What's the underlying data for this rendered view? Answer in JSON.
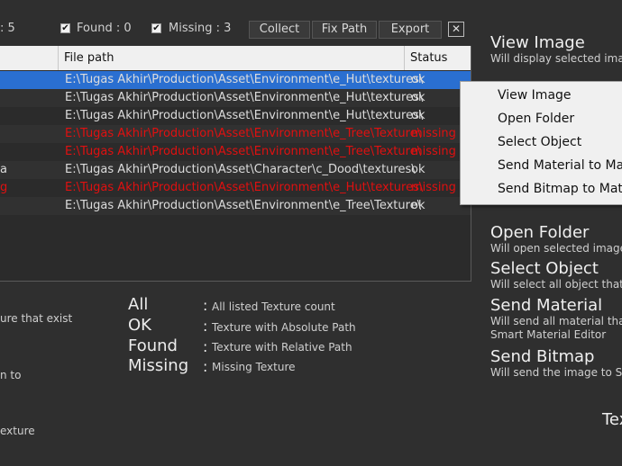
{
  "toolbar": {
    "count_fragment": ": 5",
    "found_label": "Found : 0",
    "found_checked": true,
    "missing_label": "Missing : 3",
    "missing_checked": true,
    "collect_label": "Collect",
    "fixpath_label": "Fix Path",
    "export_label": "Export",
    "close_glyph": "✕"
  },
  "table": {
    "columns": [
      "",
      "File path",
      "Status"
    ],
    "rows": [
      {
        "name": "",
        "path": "E:\\Tugas Akhir\\Production\\Asset\\Environment\\e_Hut\\textures\\",
        "status": "ok",
        "selected": true
      },
      {
        "name": "",
        "path": "E:\\Tugas Akhir\\Production\\Asset\\Environment\\e_Hut\\textures\\",
        "status": "ok",
        "selected": false
      },
      {
        "name": "",
        "path": "E:\\Tugas Akhir\\Production\\Asset\\Environment\\e_Hut\\textures\\",
        "status": "ok",
        "selected": false
      },
      {
        "name": "",
        "path": "E:\\Tugas Akhir\\Production\\Asset\\Environment\\e_Tree\\Texture\\",
        "status": "missing",
        "selected": false
      },
      {
        "name": "",
        "path": "E:\\Tugas Akhir\\Production\\Asset\\Environment\\e_Tree\\Texture\\",
        "status": "missing",
        "selected": false
      },
      {
        "name": "a",
        "path": "E:\\Tugas Akhir\\Production\\Asset\\Character\\c_Dood\\textures\\",
        "status": "ok",
        "selected": false
      },
      {
        "name": "g",
        "path": "E:\\Tugas Akhir\\Production\\Asset\\Environment\\e_Hut\\textures\\",
        "status": "missing",
        "selected": false
      },
      {
        "name": "",
        "path": "E:\\Tugas Akhir\\Production\\Asset\\Environment\\e_Tree\\Texture\\",
        "status": "ok",
        "selected": false
      }
    ]
  },
  "context_menu": {
    "items": [
      "View Image",
      "Open Folder",
      "Select Object",
      "Send Material to Mate",
      "Send Bitmap to Mater"
    ]
  },
  "legend": {
    "items": [
      {
        "term": "All",
        "desc": "All listed Texture count"
      },
      {
        "term": "OK",
        "desc": "Texture with Absolute Path"
      },
      {
        "term": "Found",
        "desc": "Texture with Relative Path"
      },
      {
        "term": "Missing",
        "desc": "Missing Texture"
      }
    ],
    "colon": ":"
  },
  "left_fragments": [
    "ure that exist",
    "n to",
    "exture"
  ],
  "help": {
    "view_image": {
      "title": "View Image",
      "desc": "Will display selected image"
    },
    "open_folder": {
      "title": "Open Folder",
      "desc": "Will open selected image fo"
    },
    "select_object": {
      "title": "Select Object",
      "desc": "Will select all object that us"
    },
    "send_material": {
      "title": "Send Material",
      "desc": "Will send all material that u",
      "desc2": "Smart Material Editor"
    },
    "send_bitmap": {
      "title": "Send Bitmap",
      "desc": "Will send the image to Sma"
    },
    "bottom_fragment": "Tex"
  }
}
